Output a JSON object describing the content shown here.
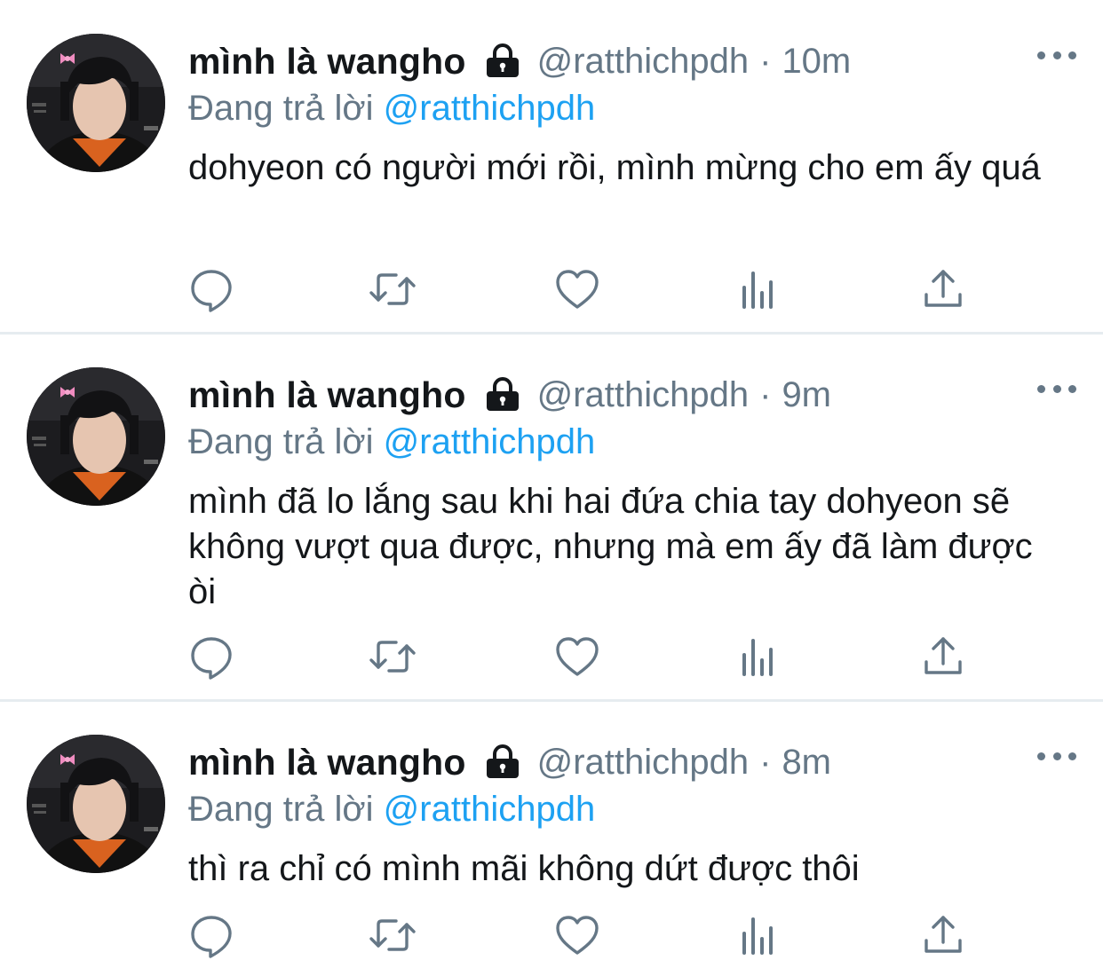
{
  "tweets": [
    {
      "display_name": "mình là wangho",
      "handle": "@ratthichpdh",
      "separator": "·",
      "time": "10m",
      "reply_prefix": "Đang trả lời",
      "reply_to": "@ratthichpdh",
      "text": "dohyeon có người mới rồi, mình mừng cho em ấy quá"
    },
    {
      "display_name": "mình là wangho",
      "handle": "@ratthichpdh",
      "separator": "·",
      "time": "9m",
      "reply_prefix": "Đang trả lời",
      "reply_to": "@ratthichpdh",
      "text": "mình đã lo lắng sau khi hai đứa chia tay dohyeon sẽ không vượt qua được, nhưng mà em ấy đã làm được òi"
    },
    {
      "display_name": "mình là wangho",
      "handle": "@ratthichpdh",
      "separator": "·",
      "time": "8m",
      "reply_prefix": "Đang trả lời",
      "reply_to": "@ratthichpdh",
      "text": "thì ra chỉ có mình mãi không dứt được thôi"
    }
  ],
  "icons": {
    "header": [
      "lock-icon",
      "more-icon"
    ],
    "actions": [
      "reply-icon",
      "retweet-icon",
      "like-icon",
      "analytics-icon",
      "share-icon"
    ]
  },
  "colors": {
    "text_primary": "#14171a",
    "text_secondary": "#657786",
    "mention": "#1da1f2",
    "divider": "#e6ecf0",
    "icon": "#657786"
  }
}
